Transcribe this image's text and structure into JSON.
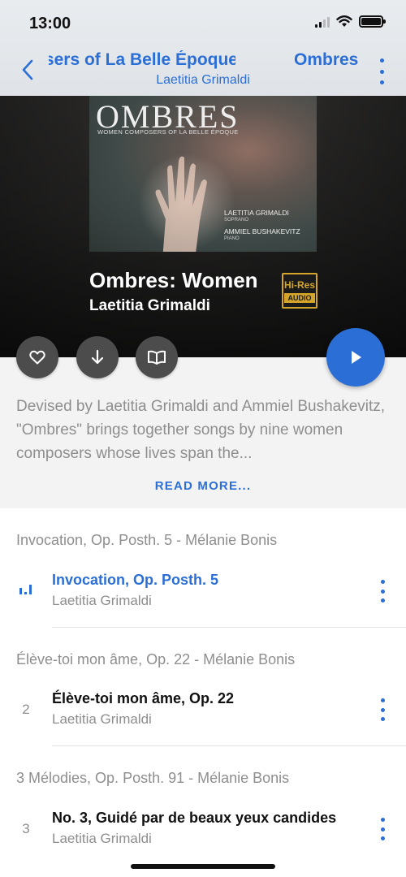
{
  "status": {
    "time": "13:00"
  },
  "nav": {
    "title": "Ombres: Women Composers of La Belle Époque",
    "next_title": "Ombres",
    "subtitle": "Laetitia Grimaldi"
  },
  "cover": {
    "title": "OMBRES",
    "subtitle": "WOMEN COMPOSERS OF LA BELLE ÉPOQUE",
    "performer1": "LAETITIA GRIMALDI",
    "role1": "SOPRANO",
    "performer2": "AMMIEL BUSHAKEVITZ",
    "role2": "PIANO"
  },
  "album": {
    "title": "Ombres: Women",
    "artist": "Laetitia Grimaldi",
    "badge_top": "Hi-Res",
    "badge_bottom": "AUDIO"
  },
  "actions": {
    "favorite_icon": "heart-icon",
    "download_icon": "download-icon",
    "booklet_icon": "book-icon",
    "play_icon": "play-icon"
  },
  "description": {
    "text": "Devised by Laetitia Grimaldi and Ammiel Bushakevitz, \"Ombres\" brings together songs by nine women composers whose lives span the...",
    "read_more": "READ MORE..."
  },
  "sections": [
    {
      "header": "Invocation, Op. Posth. 5 - Mélanie Bonis",
      "tracks": [
        {
          "number": "",
          "playing": true,
          "title": "Invocation, Op. Posth. 5",
          "artist": "Laetitia Grimaldi"
        }
      ]
    },
    {
      "header": "Élève-toi mon âme, Op. 22 - Mélanie Bonis",
      "tracks": [
        {
          "number": "2",
          "playing": false,
          "title": "Élève-toi mon âme, Op. 22",
          "artist": "Laetitia Grimaldi"
        }
      ]
    },
    {
      "header": "3 Mélodies, Op. Posth. 91 - Mélanie Bonis",
      "tracks": [
        {
          "number": "3",
          "playing": false,
          "title": "No. 3, Guidé par de beaux yeux candides",
          "artist": "Laetitia Grimaldi"
        }
      ]
    }
  ],
  "colors": {
    "accent": "#2b6fd6",
    "hires_gold": "#d4a52a",
    "muted_text": "#8e8e8e"
  }
}
